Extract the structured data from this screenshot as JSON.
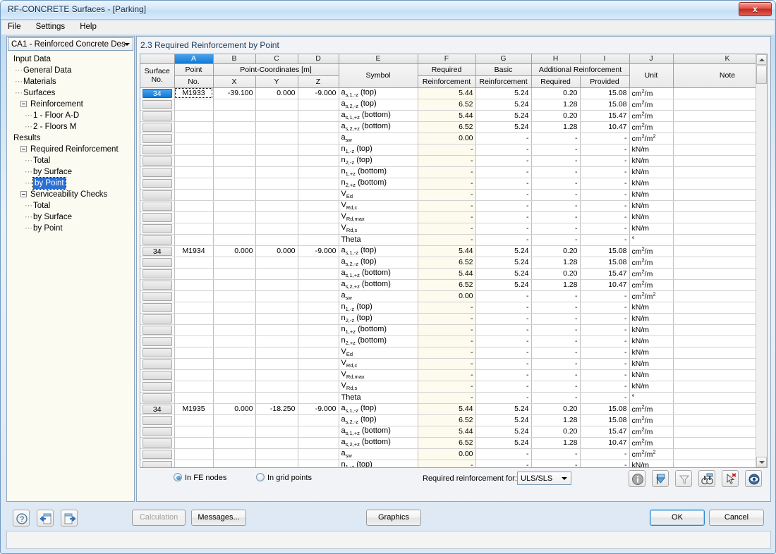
{
  "window": {
    "title": "RF-CONCRETE Surfaces - [Parking]",
    "close_label": "x"
  },
  "menubar": {
    "items": [
      {
        "label": "File"
      },
      {
        "label": "Settings"
      },
      {
        "label": "Help"
      }
    ]
  },
  "nav": {
    "combo_value": "CA1 - Reinforced Concrete Des",
    "tree": [
      {
        "label": "Input Data",
        "indent": 0,
        "expander": false,
        "dash": false,
        "selected": false
      },
      {
        "label": "General Data",
        "indent": 1,
        "expander": false,
        "dash": true,
        "selected": false
      },
      {
        "label": "Materials",
        "indent": 1,
        "expander": false,
        "dash": true,
        "selected": false
      },
      {
        "label": "Surfaces",
        "indent": 1,
        "expander": false,
        "dash": true,
        "selected": false
      },
      {
        "label": "Reinforcement",
        "indent": 1,
        "expander": true,
        "dash": false,
        "selected": false
      },
      {
        "label": "1 - Floor A-D",
        "indent": 2,
        "expander": false,
        "dash": true,
        "selected": false
      },
      {
        "label": "2 - Floors M",
        "indent": 2,
        "expander": false,
        "dash": true,
        "selected": false
      },
      {
        "label": "Results",
        "indent": 0,
        "expander": false,
        "dash": false,
        "selected": false
      },
      {
        "label": "Required Reinforcement",
        "indent": 1,
        "expander": true,
        "dash": false,
        "selected": false
      },
      {
        "label": "Total",
        "indent": 2,
        "expander": false,
        "dash": true,
        "selected": false
      },
      {
        "label": "by Surface",
        "indent": 2,
        "expander": false,
        "dash": true,
        "selected": false
      },
      {
        "label": "by Point",
        "indent": 2,
        "expander": false,
        "dash": true,
        "selected": true
      },
      {
        "label": "Serviceability Checks",
        "indent": 1,
        "expander": true,
        "dash": false,
        "selected": false
      },
      {
        "label": "Total",
        "indent": 2,
        "expander": false,
        "dash": true,
        "selected": false
      },
      {
        "label": "by Surface",
        "indent": 2,
        "expander": false,
        "dash": true,
        "selected": false
      },
      {
        "label": "by Point",
        "indent": 2,
        "expander": false,
        "dash": true,
        "selected": false
      }
    ]
  },
  "panel": {
    "title": "2.3 Required Reinforcement by Point"
  },
  "table": {
    "column_letters": [
      "",
      "A",
      "B",
      "C",
      "D",
      "E",
      "F",
      "G",
      "H",
      "I",
      "J",
      "K"
    ],
    "active_column_letter": "A",
    "header_top": {
      "surface": "Surface",
      "point": "Point",
      "coords_group": "Point-Coordinates [m]",
      "symbol": "",
      "required": "Required",
      "basic": "Basic",
      "additional_group": "Additional Reinforcement",
      "unit": "",
      "note": ""
    },
    "header_bottom": {
      "surface": "No.",
      "point": "No.",
      "x": "X",
      "y": "Y",
      "z": "Z",
      "symbol": "Symbol",
      "required": "Reinforcement",
      "basic": "Reinforcement",
      "add_required": "Required",
      "add_provided": "Provided",
      "unit": "Unit",
      "note": "Note"
    },
    "symbols": [
      {
        "base": "a",
        "sub": "s,1,-z",
        "suffix": " (top)"
      },
      {
        "base": "a",
        "sub": "s,2,-z",
        "suffix": " (top)"
      },
      {
        "base": "a",
        "sub": "s,1,+z",
        "suffix": " (bottom)"
      },
      {
        "base": "a",
        "sub": "s,2,+z",
        "suffix": " (bottom)"
      },
      {
        "base": "a",
        "sub": "sw",
        "suffix": ""
      },
      {
        "base": "n",
        "sub": "1,-z",
        "suffix": " (top)"
      },
      {
        "base": "n",
        "sub": "2,-z",
        "suffix": " (top)"
      },
      {
        "base": "n",
        "sub": "1,+z",
        "suffix": " (bottom)"
      },
      {
        "base": "n",
        "sub": "2,+z",
        "suffix": " (bottom)"
      },
      {
        "base": "V",
        "sub": "Ed",
        "suffix": ""
      },
      {
        "base": "V",
        "sub": "Rd,c",
        "suffix": ""
      },
      {
        "base": "V",
        "sub": "Rd,max",
        "suffix": ""
      },
      {
        "base": "V",
        "sub": "Rd,s",
        "suffix": ""
      },
      {
        "base": "Theta",
        "sub": "",
        "suffix": ""
      }
    ],
    "blocks": [
      {
        "surface_no": "34",
        "point_no": "M1933",
        "x": "-39.100",
        "y": "0.000",
        "z": "-9.000",
        "rows": [
          {
            "required": "5.44",
            "basic": "5.24",
            "add_required": "0.20",
            "add_provided": "15.08",
            "unit": "cm2/m",
            "note": ""
          },
          {
            "required": "6.52",
            "basic": "5.24",
            "add_required": "1.28",
            "add_provided": "15.08",
            "unit": "cm2/m",
            "note": ""
          },
          {
            "required": "5.44",
            "basic": "5.24",
            "add_required": "0.20",
            "add_provided": "15.47",
            "unit": "cm2/m",
            "note": ""
          },
          {
            "required": "6.52",
            "basic": "5.24",
            "add_required": "1.28",
            "add_provided": "10.47",
            "unit": "cm2/m",
            "note": ""
          },
          {
            "required": "0.00",
            "basic": "-",
            "add_required": "-",
            "add_provided": "-",
            "unit": "cm2/m2",
            "note": ""
          },
          {
            "required": "-",
            "basic": "-",
            "add_required": "-",
            "add_provided": "-",
            "unit": "kN/m",
            "note": ""
          },
          {
            "required": "-",
            "basic": "-",
            "add_required": "-",
            "add_provided": "-",
            "unit": "kN/m",
            "note": ""
          },
          {
            "required": "-",
            "basic": "-",
            "add_required": "-",
            "add_provided": "-",
            "unit": "kN/m",
            "note": ""
          },
          {
            "required": "-",
            "basic": "-",
            "add_required": "-",
            "add_provided": "-",
            "unit": "kN/m",
            "note": ""
          },
          {
            "required": "-",
            "basic": "-",
            "add_required": "-",
            "add_provided": "-",
            "unit": "kN/m",
            "note": ""
          },
          {
            "required": "-",
            "basic": "-",
            "add_required": "-",
            "add_provided": "-",
            "unit": "kN/m",
            "note": ""
          },
          {
            "required": "-",
            "basic": "-",
            "add_required": "-",
            "add_provided": "-",
            "unit": "kN/m",
            "note": ""
          },
          {
            "required": "-",
            "basic": "-",
            "add_required": "-",
            "add_provided": "-",
            "unit": "kN/m",
            "note": ""
          },
          {
            "required": "-",
            "basic": "-",
            "add_required": "-",
            "add_provided": "-",
            "unit": "deg",
            "note": ""
          }
        ]
      },
      {
        "surface_no": "34",
        "point_no": "M1934",
        "x": "0.000",
        "y": "0.000",
        "z": "-9.000",
        "rows": [
          {
            "required": "5.44",
            "basic": "5.24",
            "add_required": "0.20",
            "add_provided": "15.08",
            "unit": "cm2/m",
            "note": ""
          },
          {
            "required": "6.52",
            "basic": "5.24",
            "add_required": "1.28",
            "add_provided": "15.08",
            "unit": "cm2/m",
            "note": ""
          },
          {
            "required": "5.44",
            "basic": "5.24",
            "add_required": "0.20",
            "add_provided": "15.47",
            "unit": "cm2/m",
            "note": ""
          },
          {
            "required": "6.52",
            "basic": "5.24",
            "add_required": "1.28",
            "add_provided": "10.47",
            "unit": "cm2/m",
            "note": ""
          },
          {
            "required": "0.00",
            "basic": "-",
            "add_required": "-",
            "add_provided": "-",
            "unit": "cm2/m2",
            "note": ""
          },
          {
            "required": "-",
            "basic": "-",
            "add_required": "-",
            "add_provided": "-",
            "unit": "kN/m",
            "note": ""
          },
          {
            "required": "-",
            "basic": "-",
            "add_required": "-",
            "add_provided": "-",
            "unit": "kN/m",
            "note": ""
          },
          {
            "required": "-",
            "basic": "-",
            "add_required": "-",
            "add_provided": "-",
            "unit": "kN/m",
            "note": ""
          },
          {
            "required": "-",
            "basic": "-",
            "add_required": "-",
            "add_provided": "-",
            "unit": "kN/m",
            "note": ""
          },
          {
            "required": "-",
            "basic": "-",
            "add_required": "-",
            "add_provided": "-",
            "unit": "kN/m",
            "note": ""
          },
          {
            "required": "-",
            "basic": "-",
            "add_required": "-",
            "add_provided": "-",
            "unit": "kN/m",
            "note": ""
          },
          {
            "required": "-",
            "basic": "-",
            "add_required": "-",
            "add_provided": "-",
            "unit": "kN/m",
            "note": ""
          },
          {
            "required": "-",
            "basic": "-",
            "add_required": "-",
            "add_provided": "-",
            "unit": "kN/m",
            "note": ""
          },
          {
            "required": "-",
            "basic": "-",
            "add_required": "-",
            "add_provided": "-",
            "unit": "deg",
            "note": ""
          }
        ]
      },
      {
        "surface_no": "34",
        "point_no": "M1935",
        "x": "0.000",
        "y": "-18.250",
        "z": "-9.000",
        "rows": [
          {
            "required": "5.44",
            "basic": "5.24",
            "add_required": "0.20",
            "add_provided": "15.08",
            "unit": "cm2/m",
            "note": ""
          },
          {
            "required": "6.52",
            "basic": "5.24",
            "add_required": "1.28",
            "add_provided": "15.08",
            "unit": "cm2/m",
            "note": ""
          },
          {
            "required": "5.44",
            "basic": "5.24",
            "add_required": "0.20",
            "add_provided": "15.47",
            "unit": "cm2/m",
            "note": ""
          },
          {
            "required": "6.52",
            "basic": "5.24",
            "add_required": "1.28",
            "add_provided": "10.47",
            "unit": "cm2/m",
            "note": ""
          },
          {
            "required": "0.00",
            "basic": "-",
            "add_required": "-",
            "add_provided": "-",
            "unit": "cm2/m2",
            "note": ""
          },
          {
            "required": "-",
            "basic": "-",
            "add_required": "-",
            "add_provided": "-",
            "unit": "kN/m",
            "note": ""
          }
        ]
      }
    ]
  },
  "options": {
    "radio_fe_nodes": "In FE nodes",
    "radio_grid_points": "In grid points",
    "selected_radio": "In FE nodes",
    "reinforcement_for_label": "Required reinforcement for:",
    "reinforcement_for_value": "ULS/SLS",
    "toolbar_icons": [
      "info-icon",
      "filter-flag-icon",
      "funnel-icon",
      "binoculars-icon",
      "pointer-select-icon",
      "eye-visibility-icon"
    ]
  },
  "footer": {
    "icons": [
      "help-question-icon",
      "previous-arrow-icon",
      "next-arrow-icon"
    ],
    "calculation_label": "Calculation",
    "messages_label": "Messages...",
    "graphics_label": "Graphics",
    "ok_label": "OK",
    "cancel_label": "Cancel"
  },
  "colors": {
    "accent_blue": "#1179d6",
    "required_col_bg": "#fdfaee",
    "panel_bg": "#f2f3f7",
    "nav_bg": "#fbfbf2"
  }
}
